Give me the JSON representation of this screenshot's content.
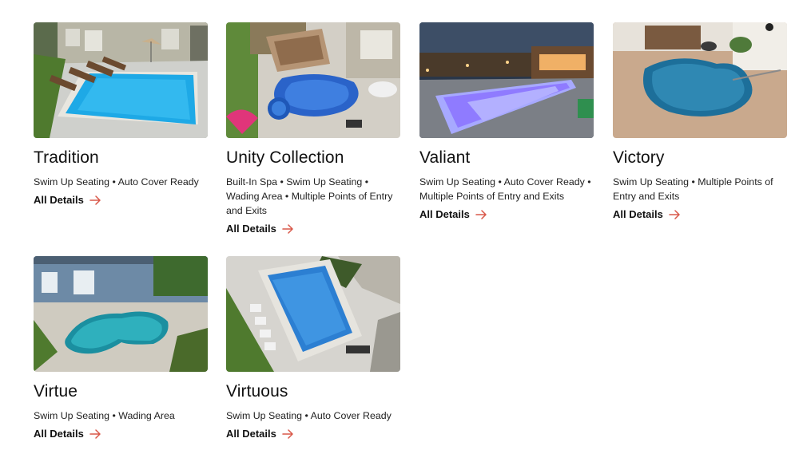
{
  "cards": [
    {
      "title": "Tradition",
      "features": "Swim Up Seating • Auto Cover Ready",
      "link": "All Details",
      "image_alt": "rectangular pool with lounge chairs beside a house"
    },
    {
      "title": "Unity Collection",
      "features": "Built-In Spa • Swim Up Seating • Wading Area • Multiple Points of Entry and Exits",
      "link": "All Details",
      "image_alt": "aerial view of freeform pool with spa and pink umbrella"
    },
    {
      "title": "Valiant",
      "features": "Swim Up Seating • Auto Cover Ready • Multiple Points of Entry and Exits",
      "link": "All Details",
      "image_alt": "illuminated pool at night with lit pavilion"
    },
    {
      "title": "Victory",
      "features": "Swim Up Seating • Multiple Points of Entry and Exits",
      "link": "All Details",
      "image_alt": "freeform pool on hexagon pavers with handrail"
    },
    {
      "title": "Virtue",
      "features": "Swim Up Seating • Wading Area",
      "link": "All Details",
      "image_alt": "kidney shaped pool beside a blue house"
    },
    {
      "title": "Virtuous",
      "features": "Swim Up Seating • Auto Cover Ready",
      "link": "All Details",
      "image_alt": "aerial view of rectangular pool with lounge chairs"
    }
  ],
  "colors": {
    "accent_arrow": "#d9584a",
    "text": "#111111"
  },
  "icons": {
    "link_arrow": "arrow-right-icon"
  }
}
